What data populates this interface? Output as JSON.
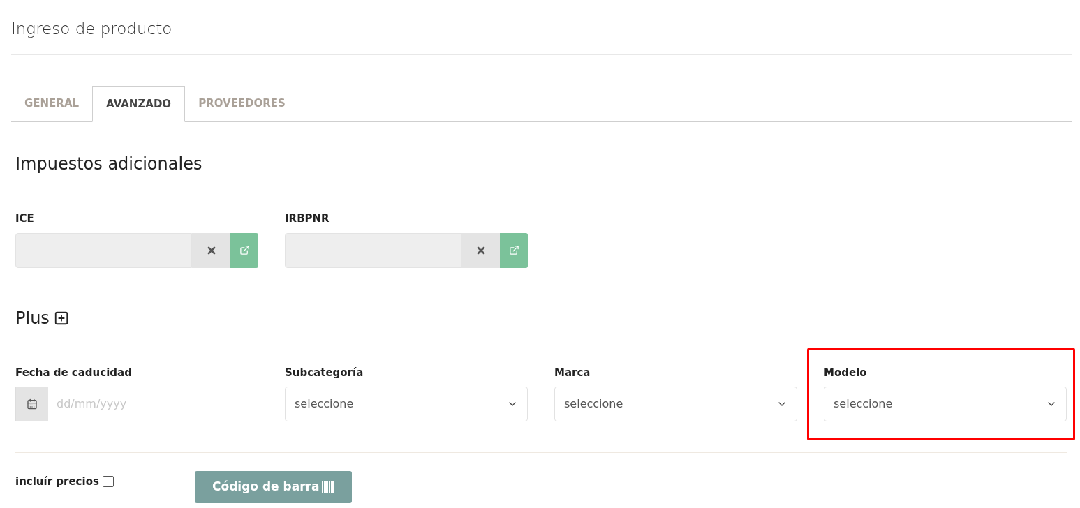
{
  "page": {
    "title": "Ingreso de producto"
  },
  "tabs": [
    {
      "label": "GENERAL",
      "selected": false
    },
    {
      "label": "AVANZADO",
      "selected": true
    },
    {
      "label": "PROVEEDORES",
      "selected": false
    }
  ],
  "sections": [
    {
      "heading": "Impuestos adicionales",
      "expandable": false,
      "fields": [
        {
          "kind": "lookup",
          "label": "ICE",
          "highlighted": false
        },
        {
          "kind": "lookup",
          "label": "IRBPNR",
          "highlighted": false
        }
      ]
    },
    {
      "heading": "Plus",
      "expandable": true,
      "fields": [
        {
          "kind": "date",
          "label": "Fecha de caducidad",
          "placeholder": "dd/mm/yyyy",
          "highlighted": false
        },
        {
          "kind": "select",
          "label": "Subcategoría",
          "value": "seleccione",
          "highlighted": false
        },
        {
          "kind": "select",
          "label": "Marca",
          "value": "seleccione",
          "highlighted": false
        },
        {
          "kind": "select",
          "label": "Modelo",
          "value": "seleccione",
          "highlighted": true
        }
      ]
    }
  ],
  "footer": {
    "checkbox": {
      "label": "incluír precios",
      "checked": false
    },
    "button": {
      "label": "Código de barra"
    }
  }
}
